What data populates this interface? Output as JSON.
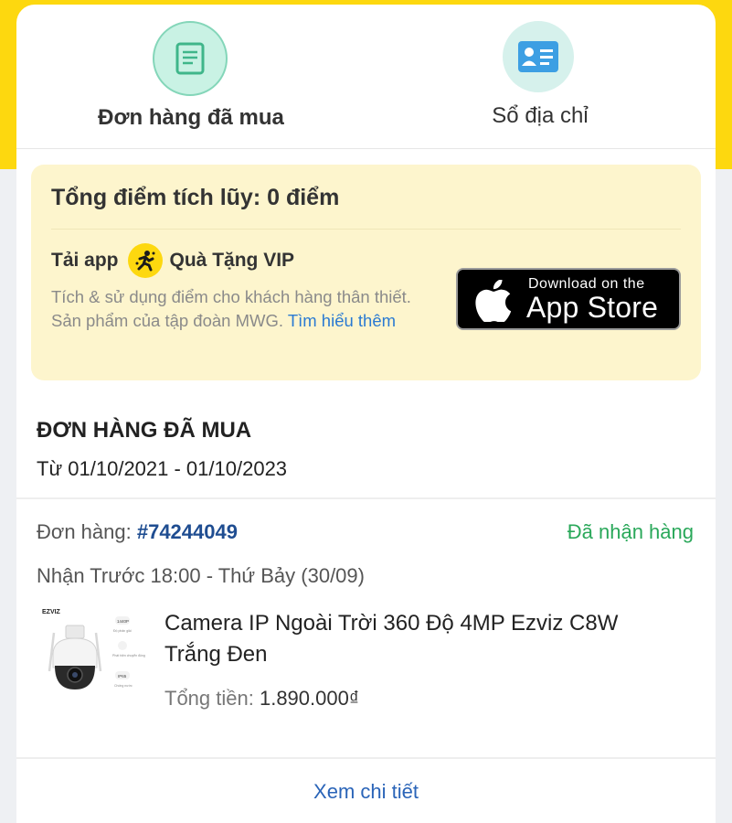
{
  "tabs": {
    "orders_label": "Đơn hàng đã mua",
    "address_label": "Sổ địa chỉ"
  },
  "points": {
    "title": "Tổng điểm tích lũy: 0 điểm",
    "download_app": "Tải app",
    "vip_gift": "Quà Tặng VIP",
    "description": "Tích & sử dụng điểm cho khách hàng thân thiết. Sản phẩm của tập đoàn MWG.",
    "learn_more": "Tìm hiểu thêm",
    "appstore_small": "Download on the",
    "appstore_big": "App Store"
  },
  "orders_section": {
    "title": "ĐƠN HÀNG ĐÃ MUA",
    "range": "Từ 01/10/2021 - 01/10/2023"
  },
  "order": {
    "label": "Đơn hàng:",
    "number": "#74244049",
    "status": "Đã nhận hàng",
    "delivery": "Nhận Trước 18:00 - Thứ Bảy (30/09)",
    "product_name": "Camera IP Ngoài Trời 360 Độ 4MP Ezviz C8W Trắng Đen",
    "total_label": "Tổng tiền:",
    "total_amount": "1.890.000₫",
    "view_detail": "Xem chi tiết",
    "product_brand": "EZVIZ",
    "product_features": [
      "1440P",
      "Độ phân giải",
      "Phát hiện chuyển động",
      "IP65",
      "Chống nước"
    ]
  },
  "colors": {
    "brand_yellow": "#fdd80f",
    "status_green": "#2aa85a",
    "order_number_blue": "#1f4d91",
    "link_blue": "#2a7ad2"
  }
}
